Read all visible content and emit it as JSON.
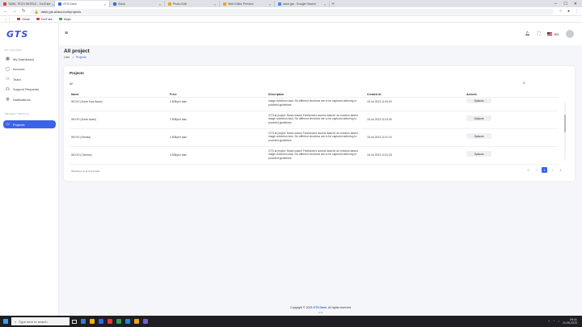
{
  "browser": {
    "tabs": [
      {
        "title": "TAMIL TECH WORLD - YouTube",
        "favicon_color": "#e53935",
        "active": false
      },
      {
        "title": "GTS Dash",
        "favicon_color": "#3c63e6",
        "active": true
      },
      {
        "title": "Slack",
        "favicon_color": "#2b6ce0",
        "active": false
      },
      {
        "title": "Photo Edit",
        "favicon_color": "#f0a020",
        "active": false
      },
      {
        "title": "Web Editor Preview",
        "favicon_color": "#f0a020",
        "active": false
      },
      {
        "title": "dash gts - Google Search",
        "favicon_color": "#4285f4",
        "active": false
      }
    ],
    "url": "dash.gts.ai/account/projects",
    "bookmarks": [
      {
        "label": "Gmail",
        "color": "#d93025"
      },
      {
        "label": "YouTube",
        "color": "#e53935"
      },
      {
        "label": "Maps",
        "color": "#34a853"
      }
    ]
  },
  "app": {
    "logo": "GTS",
    "sidebar": {
      "section_account": "MY ACCOUNT",
      "items": [
        {
          "label": "My Dashboard",
          "icon": "grid-icon"
        },
        {
          "label": "Account",
          "icon": "user-icon"
        },
        {
          "label": "Team",
          "icon": "team-icon"
        },
        {
          "label": "Support Requests",
          "icon": "headset-icon"
        },
        {
          "label": "Notifications",
          "icon": "bell-icon"
        }
      ],
      "section_projects": "PROJECT DETAILS",
      "projects_item": {
        "label": "Projects",
        "icon": "folder-icon"
      }
    },
    "topbar": {
      "lang": "EN"
    },
    "page_title": "All project",
    "breadcrumb": {
      "root": "User",
      "current": "Projects"
    },
    "card": {
      "title": "Projects",
      "search_value": "W",
      "columns": {
        "name": "Name",
        "price": "Price",
        "description": "Description",
        "created": "Created At",
        "actions": "Actions"
      },
      "rows": [
        {
          "name": "WCHO (South East Asian)",
          "price": "2.50$/per task",
          "description": "GTS.ai project: Music waves Freelancers access data for an emotion-based image collection task. Six different emotions are to be captured adhering to provided guidelines.",
          "created": "18 Jul 2023 11:05:09",
          "action": "Options"
        },
        {
          "name": "WCHO (South Asian)",
          "price": "2.50$/per task",
          "description": "GTS.ai project: Music waves Freelancers access data for an emotion-based image collection task. Six different emotions are to be captured adhering to provided guidelines.",
          "created": "18 Jul 2023 11:03:08",
          "action": "Options"
        },
        {
          "name": "WCHO (Greeks)",
          "price": "3.50$/per task",
          "description": "GTS.ai project: Music waves Freelancers access data for an emotion-based image collection task. Six different emotions are to be captured adhering to provided guidelines.",
          "created": "18 Jul 2023 11:01:15",
          "action": "Options"
        },
        {
          "name": "WCHO (Chinese)",
          "price": "3.50$/per task",
          "description": "GTS.ai project: Music waves Freelancers access data for an emotion-based image collection task. Six different emotions are to be captured adhering to provided guidelines.",
          "created": "18 Jul 2023 10:21:26",
          "action": "Options"
        }
      ],
      "showing": "Showing 1 to 8 of 8 entries",
      "pager": {
        "first": "«",
        "prev": "‹",
        "page": "1",
        "next": "›",
        "last": "»"
      }
    },
    "footer": {
      "prefix": "Copyright © 2023",
      "brand": "GTS Dash",
      "suffix": "All rights reserved",
      "version": "v1.0"
    }
  },
  "taskbar": {
    "search_placeholder": "Type here to search",
    "apps": [
      "#3a7bd5",
      "#f2b400",
      "#2b6ce0",
      "#e53935",
      "#2d9f4f",
      "#1e88e5",
      "#f0a020",
      "#7b5cd6"
    ],
    "time": "09:41",
    "date": "21-08-2023"
  }
}
